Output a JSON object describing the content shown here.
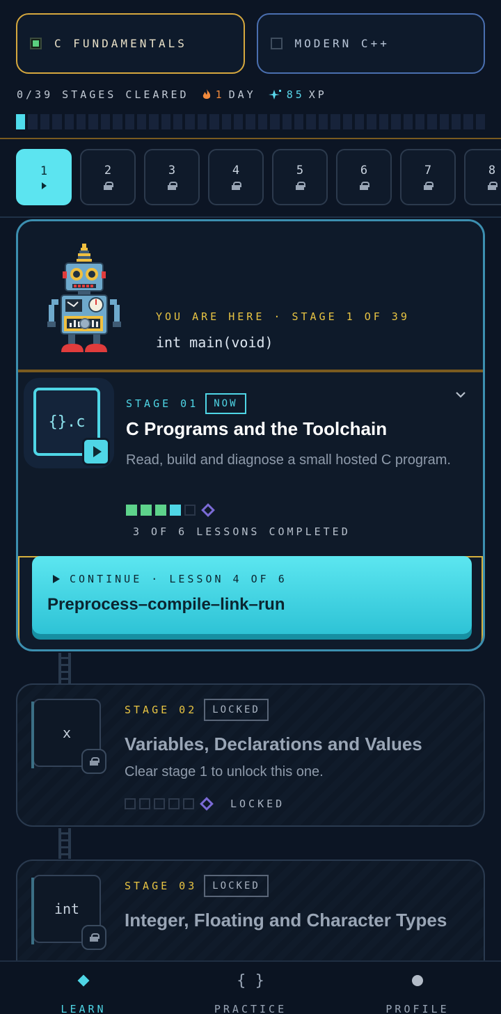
{
  "tracks": [
    {
      "label": "C FUNDAMENTALS",
      "active": true
    },
    {
      "label": "MODERN C++",
      "active": false
    }
  ],
  "stats": {
    "cleared": "0/39 STAGES CLEARED",
    "streak_num": "1",
    "streak_unit": "DAY",
    "xp_num": "85",
    "xp_unit": "XP"
  },
  "progress": {
    "filled": 1,
    "total": 39
  },
  "stage_tabs": [
    {
      "num": "1",
      "state": "current"
    },
    {
      "num": "2",
      "state": "locked"
    },
    {
      "num": "3",
      "state": "locked"
    },
    {
      "num": "4",
      "state": "locked"
    },
    {
      "num": "5",
      "state": "locked"
    },
    {
      "num": "6",
      "state": "locked"
    },
    {
      "num": "7",
      "state": "locked"
    },
    {
      "num": "8",
      "state": "locked"
    }
  ],
  "current": {
    "here": "YOU ARE HERE · STAGE 1 OF 39",
    "signature": "int main(void)",
    "stage_num": "STAGE 01",
    "badge": "NOW",
    "icon_text": "{}.c",
    "title": "C Programs and the Toolchain",
    "desc": "Read, build and diagnose a small hosted C program.",
    "lessons_done": "3 OF 6 LESSONS COMPLETED",
    "continue_label": "CONTINUE · LESSON 4 OF 6",
    "continue_title": "Preprocess–compile–link–run"
  },
  "locked": [
    {
      "stage_num": "STAGE 02",
      "badge": "LOCKED",
      "icon_text": "x",
      "title": "Variables, Declarations and Values",
      "desc": "Clear stage 1 to unlock this one.",
      "state": "LOCKED"
    },
    {
      "stage_num": "STAGE 03",
      "badge": "LOCKED",
      "icon_text": "int",
      "title": "Integer, Floating and Character Types"
    }
  ],
  "nav": [
    {
      "label": "LEARN",
      "icon": "diamond-icon",
      "active": true
    },
    {
      "label": "PRACTICE",
      "icon_text": "{ }",
      "active": false
    },
    {
      "label": "PROFILE",
      "icon": "dot-icon",
      "active": false
    }
  ],
  "colors": {
    "accent": "#4fd6e6",
    "gold": "#d6b03e",
    "green": "#5ed38b"
  }
}
